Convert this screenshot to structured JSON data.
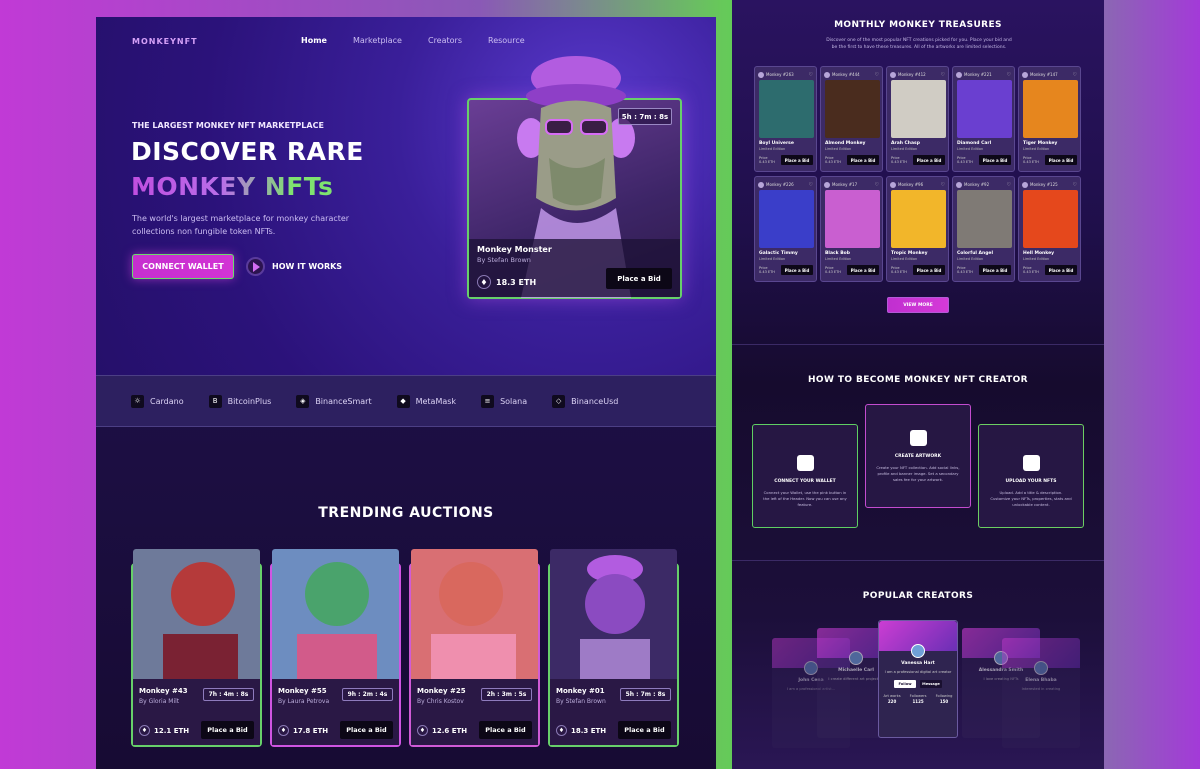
{
  "left": {
    "logo": "MONKEYNFT",
    "nav": [
      "Home",
      "Marketplace",
      "Creators",
      "Resource"
    ],
    "eyebrow": "THE LARGEST MONKEY NFT MARKETPLACE",
    "title_line1": "DISCOVER RARE",
    "title_line2": "MONKEY NFTs",
    "description": "The world's largest marketplace for monkey character collections non fungible token NFTs.",
    "connect_label": "CONNECT WALLET",
    "how_label": "HOW IT WORKS",
    "hero_card": {
      "timer": "5h : 7m : 8s",
      "name": "Monkey Monster",
      "by": "By Stefan Brown",
      "price": "18.3 ETH",
      "bid": "Place a Bid"
    },
    "partners": [
      {
        "icon": "☼",
        "label": "Cardano"
      },
      {
        "icon": "B",
        "label": "BitcoinPlus"
      },
      {
        "icon": "◈",
        "label": "BinanceSmart"
      },
      {
        "icon": "◆",
        "label": "MetaMask"
      },
      {
        "icon": "≡",
        "label": "Solana"
      },
      {
        "icon": "◇",
        "label": "BinanceUsd"
      }
    ],
    "trending_title": "TRENDING AUCTIONS",
    "auctions": [
      {
        "name": "Monkey #43",
        "by": "By Gloria Milt",
        "timer": "7h : 4m : 8s",
        "price": "12.1 ETH",
        "bid": "Place a Bid",
        "color": "#b53a3a"
      },
      {
        "name": "Monkey #55",
        "by": "By Laura Petrova",
        "timer": "9h : 2m : 4s",
        "price": "17.8 ETH",
        "bid": "Place a Bid",
        "color": "#4aa36c"
      },
      {
        "name": "Monkey #25",
        "by": "By Chris Kostov",
        "timer": "2h : 3m : 5s",
        "price": "12.6 ETH",
        "bid": "Place a Bid",
        "color": "#d9685e"
      },
      {
        "name": "Monkey #01",
        "by": "By Stefan Brown",
        "timer": "5h : 7m : 8s",
        "price": "18.3 ETH",
        "bid": "Place a Bid",
        "color": "#8b4bc1"
      }
    ]
  },
  "right": {
    "treasures_title": "MONTHLY MONKEY TREASURES",
    "treasures_sub": "Discover one of the most popular NFT creations picked for you. Place your bid and be the first to have these treasures. All of the artworks are limited selections.",
    "nfts": [
      {
        "tag": "Monkey #263",
        "name": "Boyl Universe",
        "bg": "#2d6c6e"
      },
      {
        "tag": "Monkey #444",
        "name": "Almond Monkey",
        "bg": "#4a2c1e"
      },
      {
        "tag": "Monkey #412",
        "name": "Arah Chasp",
        "bg": "#d0ccc4"
      },
      {
        "tag": "Monkey #221",
        "name": "Diamond Carl",
        "bg": "#6a3fd0"
      },
      {
        "tag": "Monkey #147",
        "name": "Tiger Monkey",
        "bg": "#e6861e"
      },
      {
        "tag": "Monkey #226",
        "name": "Galactic Timmy",
        "bg": "#3a3ec9"
      },
      {
        "tag": "Monkey #17",
        "name": "Black Bob",
        "bg": "#c95fd0"
      },
      {
        "tag": "Monkey #96",
        "name": "Tropic Monkey",
        "bg": "#f2b62a"
      },
      {
        "tag": "Monkey #92",
        "name": "Colorful Angel",
        "bg": "#7f7a75"
      },
      {
        "tag": "Monkey #125",
        "name": "Hell Monkey",
        "bg": "#e5481c"
      }
    ],
    "nft_edition": "Limited Edition",
    "nft_price_label": "Price",
    "nft_price": "0.43 ETH",
    "nft_bid": "Place a Bid",
    "view_more": "VIEW MORE",
    "howto_title": "HOW TO BECOME MONKEY NFT CREATOR",
    "steps": [
      {
        "title": "CONNECT YOUR WALLET",
        "desc": "Connect your Wallet, use the pink button in the left of the Header. Now you can use any feature."
      },
      {
        "title": "CREATE ARTWORK",
        "desc": "Create your NFT collection. Add social links, profile and banner image. Set a secondary sales fee for your artwork."
      },
      {
        "title": "UPLOAD YOUR NFTS",
        "desc": "Upload. Add a title & description. Customize your NFTs, properties, stats and unlockable content."
      }
    ],
    "creators_title": "POPULAR CREATORS",
    "creators": [
      {
        "name": "John Cena",
        "bio": "I am a professional artist..."
      },
      {
        "name": "Michaelle Carl",
        "bio": "I create different art projects..."
      },
      {
        "name": "Vanessa Hart",
        "bio": "I am a professional digital art creator"
      },
      {
        "name": "Alessandra Smith",
        "bio": "I love creating NFTs"
      },
      {
        "name": "Elena Bhaba",
        "bio": "Interested in creating"
      }
    ],
    "follow": "Follow",
    "message": "Message",
    "stat_labels": [
      "Art works",
      "Followers",
      "Following"
    ],
    "main_stats": [
      "220",
      "1125",
      "150"
    ]
  }
}
